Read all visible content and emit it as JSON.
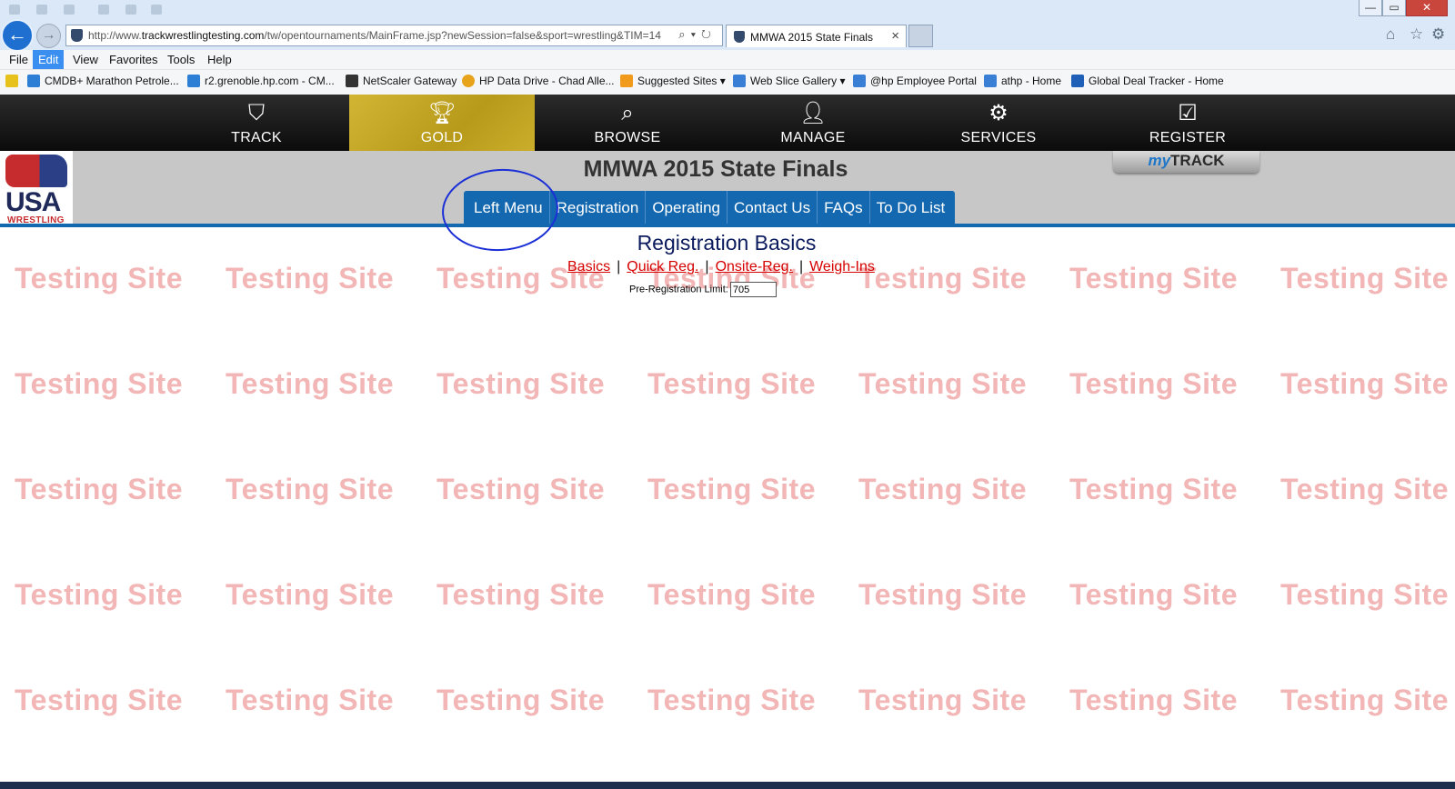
{
  "browser": {
    "address_url_prefix": "http://www.",
    "address_url_domain": "trackwrestlingtesting.com",
    "address_url_path": "/tw/opentournaments/MainFrame.jsp?newSession=false&sport=wrestling&TIM=14",
    "tab_title": "MMWA 2015 State Finals",
    "window_controls": {
      "minimize": "—",
      "maximize": "▭",
      "close": "✕"
    },
    "menu": [
      "File",
      "Edit",
      "View",
      "Favorites",
      "Tools",
      "Help"
    ],
    "favorites": [
      {
        "label": "CMDB+ Marathon Petrole...",
        "icon_color": "#2d7fd6"
      },
      {
        "label": "r2.grenoble.hp.com - CM...",
        "icon_color": "#2d7fd6"
      },
      {
        "label": "NetScaler Gateway",
        "icon_color": "#333333"
      },
      {
        "label": "HP Data Drive - Chad Alle...",
        "icon_color": "#e8a31c"
      },
      {
        "label": "Suggested Sites ▾",
        "icon_color": "#f29a1c"
      },
      {
        "label": "Web Slice Gallery ▾",
        "icon_color": "#3a7fd6"
      },
      {
        "label": "@hp Employee Portal",
        "icon_color": "#3a7fd6"
      },
      {
        "label": "athp - Home",
        "icon_color": "#3a7fd6"
      },
      {
        "label": "Global Deal Tracker - Home",
        "icon_color": "#1f5fb8"
      }
    ]
  },
  "site_nav": [
    {
      "label": "TRACK",
      "icon": "shield-icon"
    },
    {
      "label": "GOLD",
      "icon": "trophy-icon"
    },
    {
      "label": "BROWSE",
      "icon": "search-icon"
    },
    {
      "label": "MANAGE",
      "icon": "user-icon"
    },
    {
      "label": "SERVICES",
      "icon": "gear-icon"
    },
    {
      "label": "REGISTER",
      "icon": "clipboard-check-icon"
    }
  ],
  "logo": {
    "line1": "USA",
    "line2": "WRESTLING"
  },
  "event_title": "MMWA 2015 State Finals",
  "mytrack": {
    "my": "my",
    "track": "TRACK"
  },
  "tabs": [
    "Left Menu",
    "Registration",
    "Operating",
    "Contact Us",
    "FAQs",
    "To Do List"
  ],
  "watermark_text": "Testing Site",
  "page": {
    "heading": "Registration Basics",
    "links": [
      "Basics",
      "Quick Reg.",
      "Onsite-Reg.",
      "Weigh-Ins"
    ],
    "separator": "|",
    "prereg_label": "Pre-Registration Limit:",
    "prereg_value": "705"
  },
  "colors": {
    "gold_tab": "#c4a626",
    "blue_tabs": "#1468b0",
    "heading": "#0b1b5e",
    "link": "#d60000",
    "watermark": "#f3b6b6",
    "annotation": "#1b2fd6"
  }
}
